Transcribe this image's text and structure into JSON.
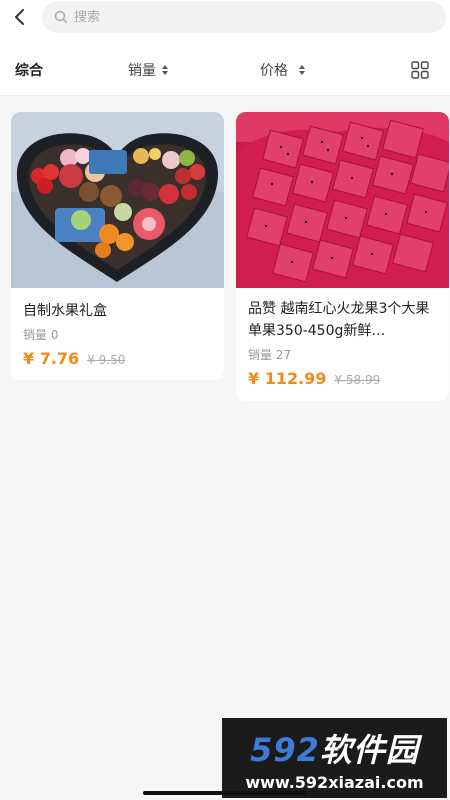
{
  "search": {
    "placeholder": "搜索",
    "back_icon": "back-arrow-icon",
    "search_icon": "search-icon"
  },
  "sort_bar": {
    "items": [
      {
        "label": "综合",
        "active": true
      },
      {
        "label": "销量",
        "icon": "sort-updown-icon"
      },
      {
        "label": "价格",
        "icon": "sort-updown-icon"
      }
    ],
    "layout_icon": "grid-icon"
  },
  "products": [
    {
      "title": "自制水果礼盒",
      "sales_label": "销量",
      "sales": "0",
      "price": "¥ 7.76",
      "original_price": "¥ 9.50"
    },
    {
      "title": "品赞 越南红心火龙果3个大果单果350-450g新鲜…",
      "sales_label": "销量",
      "sales": "27",
      "price": "¥ 112.99",
      "original_price": "¥ 58.99"
    }
  ],
  "watermark": {
    "brand_num": "592",
    "brand_text": "软件园",
    "url": "www.592xiazai.com"
  },
  "colors": {
    "price": "#f28a1a",
    "watermark_blue": "#3e7bd9"
  }
}
